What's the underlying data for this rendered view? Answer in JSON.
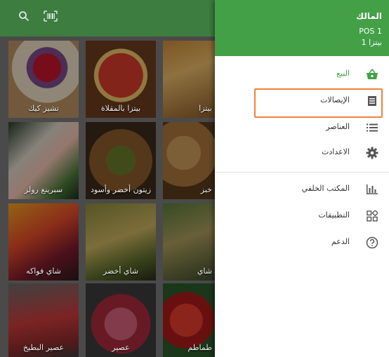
{
  "colors": {
    "brand_green": "#43a047",
    "highlight": "#f0813a"
  },
  "toolbar": {
    "search_icon": "search-icon",
    "barcode_icon": "barcode-icon"
  },
  "products": [
    {
      "name": "تشيز كيك"
    },
    {
      "name": "بيتزا بالمقلاة"
    },
    {
      "name": "بيتزا"
    },
    {
      "name": "سبرينغ رولز"
    },
    {
      "name": "زيتون أخضر وأسود"
    },
    {
      "name": "خبز"
    },
    {
      "name": "شاي فواكه"
    },
    {
      "name": "شاي أخضر"
    },
    {
      "name": "شاي"
    },
    {
      "name": "عصير البطيخ"
    },
    {
      "name": "عصير"
    },
    {
      "name": "طماطم"
    }
  ],
  "drawer": {
    "owner": "المالك",
    "pos": "POS 1",
    "store": "بيتزا 1",
    "main_menu": [
      {
        "label": "البيع",
        "icon": "basket-icon"
      },
      {
        "label": "الإيصالات",
        "icon": "receipt-icon"
      },
      {
        "label": "العناصر",
        "icon": "list-icon"
      },
      {
        "label": "الاعدادت",
        "icon": "gear-icon"
      }
    ],
    "secondary_menu": [
      {
        "label": "المكتب الخلفي",
        "icon": "bar-chart-icon"
      },
      {
        "label": "التطبيقات",
        "icon": "apps-icon"
      },
      {
        "label": "الدعم",
        "icon": "help-icon"
      }
    ]
  }
}
